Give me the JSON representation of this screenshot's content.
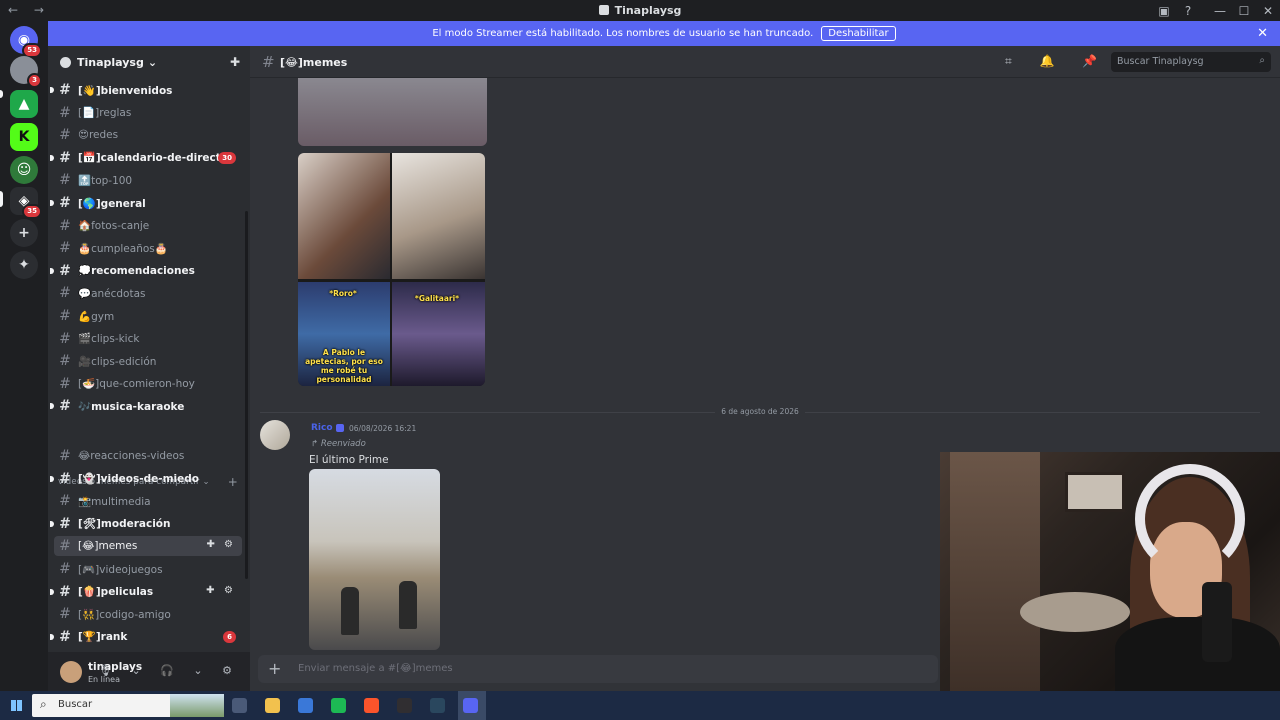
{
  "window": {
    "title": "Tinaplaysg",
    "nav": "← →",
    "controls": [
      "▣",
      "?",
      "—",
      "☐",
      "✕"
    ]
  },
  "banner": {
    "text": "El modo Streamer está habilitado. Los nombres de usuario se han truncado.",
    "button": "Deshabilitar",
    "close": "✕"
  },
  "servers": [
    {
      "name": "discord-home",
      "glyph": "◉",
      "badge": "53",
      "color": "#5865f2"
    },
    {
      "name": "server-1",
      "glyph": "",
      "badge": "3",
      "color": "#8a8f98"
    },
    {
      "name": "server-2",
      "glyph": "▲",
      "badge": "",
      "color": "#1fa84a"
    },
    {
      "name": "server-3",
      "glyph": "K",
      "badge": "",
      "color": "#53fc18"
    },
    {
      "name": "server-4",
      "glyph": "☺",
      "badge": "",
      "color": "#2f7a3a"
    },
    {
      "name": "server-5",
      "glyph": "◈",
      "badge": "35",
      "color": "#2b2d31"
    },
    {
      "name": "add-server",
      "glyph": "+",
      "badge": "",
      "color": "#2b2d31"
    },
    {
      "name": "explore",
      "glyph": "✦",
      "badge": "",
      "color": "#2b2d31"
    }
  ],
  "guild": {
    "name": "Tinaplaysg",
    "chevron": "⌄",
    "invite_icon": "✚"
  },
  "channels": [
    {
      "label": "[👋]bienvenidos",
      "unread": true,
      "badge": ""
    },
    {
      "label": "[📄]reglas",
      "unread": false,
      "badge": ""
    },
    {
      "label": "😍redes",
      "unread": false,
      "badge": ""
    },
    {
      "label": "[📅]calendario-de-directo",
      "unread": true,
      "badge": "30"
    },
    {
      "label": "🔝top-100",
      "unread": false,
      "badge": ""
    },
    {
      "label": "[🌎]general",
      "unread": true,
      "badge": ""
    },
    {
      "label": "🏠fotos-canje",
      "unread": false,
      "badge": ""
    },
    {
      "label": "🎂cumpleaños🎂",
      "unread": false,
      "badge": ""
    },
    {
      "label": "💭recomendaciones",
      "unread": true,
      "badge": ""
    },
    {
      "label": "💬anécdotas",
      "unread": false,
      "badge": ""
    },
    {
      "label": "💪gym",
      "unread": false,
      "badge": ""
    },
    {
      "label": "🎬clips-kick",
      "unread": false,
      "badge": ""
    },
    {
      "label": "🎥clips-edición",
      "unread": false,
      "badge": ""
    },
    {
      "label": "[🍜]que-comieron-hoy",
      "unread": false,
      "badge": ""
    },
    {
      "label": "🎶musica-karaoke",
      "unread": true,
      "badge": ""
    }
  ],
  "category": {
    "label": "videos o memes para compartir ⌄",
    "add": "+"
  },
  "channels2": [
    {
      "label": "😂reacciones-videos",
      "unread": false,
      "badge": ""
    },
    {
      "label": "[👻]videos-de-miedo",
      "unread": true,
      "badge": ""
    },
    {
      "label": "📸multimedia",
      "unread": false,
      "badge": ""
    },
    {
      "label": "[🛠]moderación",
      "unread": true,
      "badge": ""
    },
    {
      "label": "[😂]memes",
      "unread": false,
      "active": true,
      "badge": ""
    },
    {
      "label": "[🎮]videojuegos",
      "unread": false,
      "badge": ""
    },
    {
      "label": "[🍿]peliculas",
      "unread": true,
      "badge": ""
    },
    {
      "label": "[👯]codigo-amigo",
      "unread": false,
      "badge": ""
    },
    {
      "label": "[🏆]rank",
      "unread": true,
      "badge": "6"
    }
  ],
  "channel_tools": "✚ ⚙",
  "user": {
    "name": "tinaplays",
    "status": "En línea",
    "icons": "🎙 ⌄ 🎧 ⌄ ⚙"
  },
  "header": {
    "channel": "[😂]memes",
    "icons": "⌗ 🔔 📌 👥",
    "search_placeholder": "Buscar Tinaplaysg",
    "search_icon": "⌕"
  },
  "messages": {
    "collage_captions": [
      "*Roro*",
      "*Galitaari*",
      "A Pablo le apetecias, por eso me robé tu personalidad"
    ],
    "date_divider": "6 de agosto de 2026",
    "author": "Rico",
    "timestamp": "06/08/2026 16:21",
    "forwarded": "↱ Reenviado",
    "text": "El último Prime"
  },
  "composer": {
    "plus": "+",
    "placeholder": "Enviar mensaje a #[😂]memes"
  },
  "taskbar": {
    "search": "Buscar",
    "search_icon": "⌕",
    "apps": [
      {
        "name": "task-view",
        "color": "#4a5a78"
      },
      {
        "name": "file-explorer",
        "color": "#f2c14e"
      },
      {
        "name": "app-blue",
        "color": "#3a78d8"
      },
      {
        "name": "spotify",
        "color": "#1db954"
      },
      {
        "name": "brave",
        "color": "#fb542b"
      },
      {
        "name": "obs",
        "color": "#302e31"
      },
      {
        "name": "steam",
        "color": "#2a475e"
      },
      {
        "name": "discord",
        "color": "#5865f2"
      }
    ]
  },
  "colors": {
    "accent": "#5865f2",
    "badge": "#da373c",
    "background": "#313338"
  }
}
